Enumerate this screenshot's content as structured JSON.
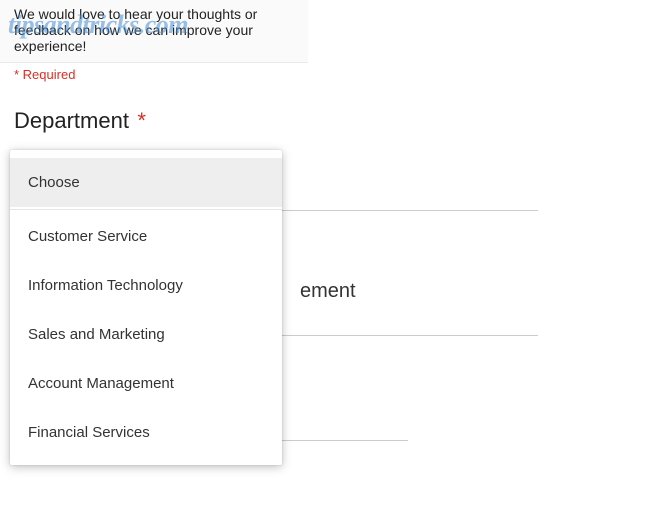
{
  "watermark": "tipsandtricks.com",
  "form": {
    "description": "We would love to hear your thoughts or feedback on how we can improve your experience!",
    "required_note": "* Required"
  },
  "question": {
    "label": "Department",
    "star": "*",
    "selected": "Choose"
  },
  "dropdown": {
    "placeholder": "Choose",
    "options": [
      "Customer Service",
      "Information Technology",
      "Sales and Marketing",
      "Account Management",
      "Financial Services"
    ]
  },
  "background": {
    "partial_text": "ement"
  }
}
